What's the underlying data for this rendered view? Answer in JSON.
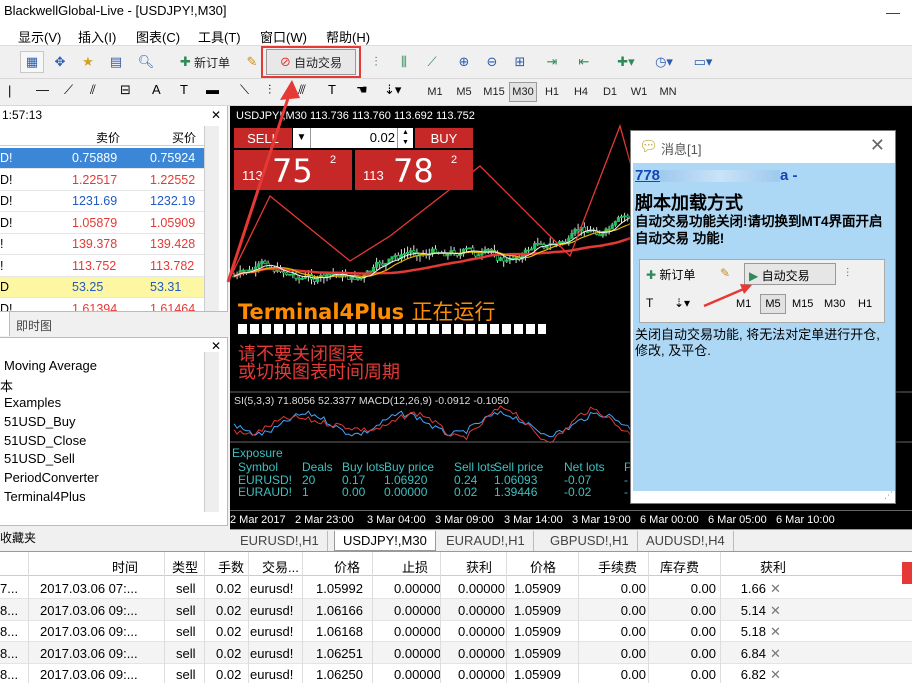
{
  "window": {
    "title": "BlackwellGlobal-Live - [USDJPY!,M30]",
    "minimize": "—"
  },
  "menu": [
    "显示(V)",
    "插入(I)",
    "图表(C)",
    "工具(T)",
    "窗口(W)",
    "帮助(H)"
  ],
  "toolbar": {
    "new_order": "新订单",
    "auto_trade": "自动交易"
  },
  "timeframes": [
    "M1",
    "M5",
    "M15",
    "M30",
    "H1",
    "H4",
    "D1",
    "W1",
    "MN"
  ],
  "active_timeframe": "M30",
  "market_watch": {
    "time": "1:57:13",
    "col_bid": "卖价",
    "col_ask": "买价",
    "rows": [
      {
        "sym": "D!",
        "bid": "0.75889",
        "ask": "0.75924",
        "selected": true
      },
      {
        "sym": "D!",
        "bid": "1.22517",
        "ask": "1.22552",
        "color": "#e53935"
      },
      {
        "sym": "D!",
        "bid": "1231.69",
        "ask": "1232.19",
        "color": "#1e5bc6"
      },
      {
        "sym": "D!",
        "bid": "1.05879",
        "ask": "1.05909",
        "color": "#e53935"
      },
      {
        "sym": "!",
        "bid": "139.378",
        "ask": "139.428",
        "color": "#e53935"
      },
      {
        "sym": "!",
        "bid": "113.752",
        "ask": "113.782",
        "color": "#e53935"
      },
      {
        "sym": "D",
        "bid": "53.25",
        "ask": "53.31",
        "color": "#1e5bc6",
        "yellow": true
      },
      {
        "sym": "D!",
        "bid": "1.61394",
        "ask": "1.61464",
        "color": "#e53935"
      }
    ],
    "tab_tick": "即时图"
  },
  "navigator": {
    "items": [
      "Moving Average",
      "本",
      "Examples",
      "51USD_Buy",
      "51USD_Close",
      "51USD_Sell",
      "PeriodConverter",
      "Terminal4Plus"
    ],
    "tab": "收藏夹"
  },
  "chart": {
    "symbol_label": "USDJPY!,M30  113.736 113.760 113.692 113.752",
    "sell": "SELL",
    "buy": "BUY",
    "lot": "0.02",
    "sell_small": "113",
    "sell_big": "75",
    "sell_sup": "2",
    "buy_small": "113",
    "buy_big": "78",
    "buy_sup": "2",
    "t4p_name": "Terminal4Plus",
    "t4p_status": "正在运行",
    "warn1": "请不要关闭图表",
    "warn2": "或切换图表时间周期",
    "indicator": "SI(5,3,3) 71.8056 52.3377  MACD(12,26,9) -0.0912 -0.1050",
    "exposure": {
      "title": "Exposure",
      "headers": [
        "Symbol",
        "Deals",
        "Buy lots",
        "Buy price",
        "Sell lots",
        "Sell price",
        "Net lots",
        "P"
      ],
      "rows": [
        [
          "EURUSD!",
          "20",
          "0.17",
          "1.06920",
          "0.24",
          "1.06093",
          "-0.07",
          "-"
        ],
        [
          "EURAUD!",
          "1",
          "0.00",
          "0.00000",
          "0.02",
          "1.39446",
          "-0.02",
          "-"
        ]
      ]
    },
    "xaxis": [
      "2 Mar 2017",
      "2 Mar 23:00",
      "3 Mar 04:00",
      "3 Mar 09:00",
      "3 Mar 14:00",
      "3 Mar 19:00",
      "6 Mar 00:00",
      "6 Mar 05:00",
      "6 Mar 10:00"
    ]
  },
  "chart_tabs": [
    "EURUSD!,H1",
    "USDJPY!,M30",
    "EURAUD!,H1",
    "GBPUSD!,H1",
    "AUDUSD!,H4"
  ],
  "active_chart_tab": "USDJPY!,M30",
  "popup": {
    "title": "消息[1]",
    "link": "778",
    "link_suffix": "a -",
    "heading": "脚本加载方式",
    "text1": "自动交易功能关闭!请切换到MT4界面开启自动交易 功能!",
    "inner_new_order": "新订单",
    "inner_auto": "自动交易",
    "inner_tfs": [
      "M1",
      "M5",
      "M15",
      "M30",
      "H1"
    ],
    "text2": "关闭自动交易功能, 将无法对定单进行开仓, 修改, 及平仓."
  },
  "terminal": {
    "headers": [
      "时间",
      "类型",
      "手数",
      "交易...",
      "价格",
      "止损",
      "获利",
      "价格",
      "手续费",
      "库存费",
      "获利"
    ],
    "rows": [
      [
        "7...",
        "2017.03.06 07:...",
        "sell",
        "0.02",
        "eurusd!",
        "1.05992",
        "0.00000",
        "0.00000",
        "1.05909",
        "0.00",
        "0.00",
        "1.66"
      ],
      [
        "8...",
        "2017.03.06 09:...",
        "sell",
        "0.02",
        "eurusd!",
        "1.06166",
        "0.00000",
        "0.00000",
        "1.05909",
        "0.00",
        "0.00",
        "5.14"
      ],
      [
        "8...",
        "2017.03.06 09:...",
        "sell",
        "0.02",
        "eurusd!",
        "1.06168",
        "0.00000",
        "0.00000",
        "1.05909",
        "0.00",
        "0.00",
        "5.18"
      ],
      [
        "8...",
        "2017.03.06 09:...",
        "sell",
        "0.02",
        "eurusd!",
        "1.06251",
        "0.00000",
        "0.00000",
        "1.05909",
        "0.00",
        "0.00",
        "6.84"
      ],
      [
        "8...",
        "2017.03.06 09:...",
        "sell",
        "0.02",
        "eurusd!",
        "1.06250",
        "0.00000",
        "0.00000",
        "1.05909",
        "0.00",
        "0.00",
        "6.82"
      ]
    ]
  },
  "colors": {
    "accent_red": "#c62828",
    "popup_bg": "#add8f5",
    "t4p_orange": "#ff8c00",
    "exposure_cyan": "#40bfbf"
  }
}
